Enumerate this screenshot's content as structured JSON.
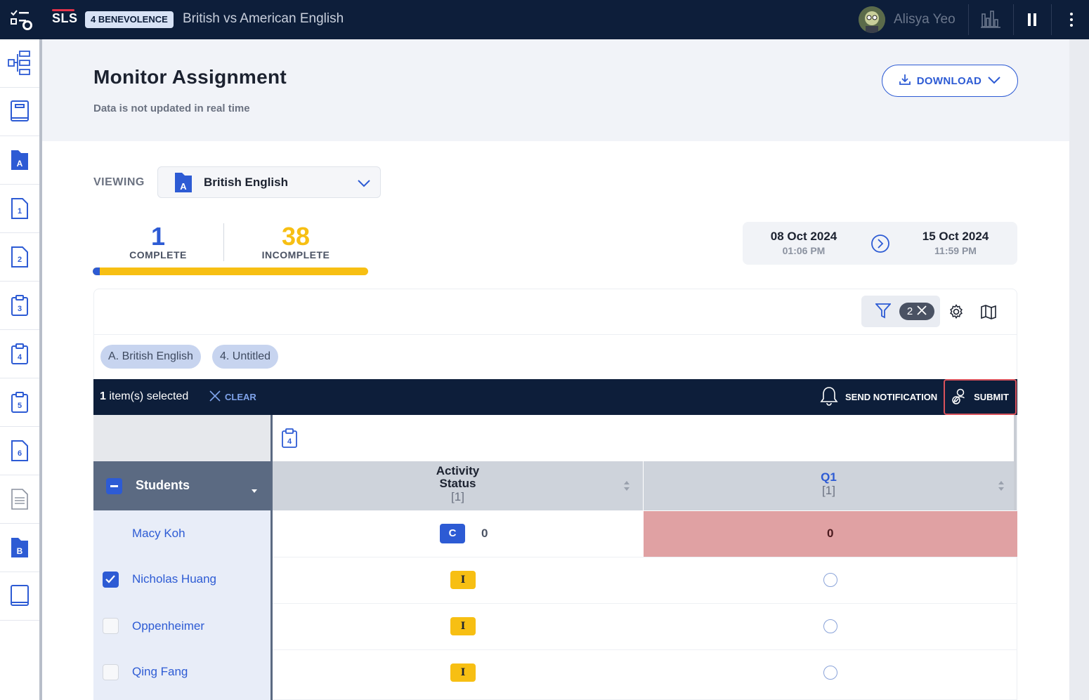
{
  "topbar": {
    "logo": "SLS",
    "class_badge": "4 BENEVOLENCE",
    "lesson_title": "British vs American English",
    "user_name": "Alisya Yeo"
  },
  "rail": {
    "items": [
      {
        "icon": "tree-structure-icon"
      },
      {
        "icon": "book-icon"
      },
      {
        "icon": "folder-a-icon",
        "label": "A"
      },
      {
        "icon": "page-1-icon",
        "label": "1"
      },
      {
        "icon": "page-2-icon",
        "label": "2"
      },
      {
        "icon": "clipboard-3-icon",
        "label": "3"
      },
      {
        "icon": "clipboard-4-icon",
        "label": "4"
      },
      {
        "icon": "clipboard-5-icon",
        "label": "5"
      },
      {
        "icon": "page-6-icon",
        "label": "6"
      },
      {
        "icon": "document-icon"
      },
      {
        "icon": "folder-b-icon",
        "label": "B"
      },
      {
        "icon": "book-end-icon"
      }
    ]
  },
  "header": {
    "title": "Monitor Assignment",
    "subtitle": "Data is not updated in real time",
    "download_label": "DOWNLOAD"
  },
  "viewing": {
    "label": "VIEWING",
    "folder_letter": "A",
    "selected": "British English"
  },
  "stats": {
    "complete_count": "1",
    "complete_label": "COMPLETE",
    "incomplete_count": "38",
    "incomplete_label": "INCOMPLETE",
    "progress_fraction": 0.026
  },
  "dates": {
    "start_date": "08 Oct 2024",
    "start_time": "01:06 PM",
    "end_date": "15 Oct 2024",
    "end_time": "11:59 PM"
  },
  "filters": {
    "count": "2",
    "chips": [
      "A. British English",
      "4. Untitled"
    ]
  },
  "selection": {
    "count": "1",
    "text": "item(s) selected",
    "clear": "CLEAR",
    "notify": "SEND NOTIFICATION",
    "submit": "SUBMIT"
  },
  "table": {
    "group_number": "4",
    "students_header": "Students",
    "col_activity_1": "Activity",
    "col_activity_2": "Status",
    "col_activity_sub": "[1]",
    "col_q1": "Q1",
    "col_q1_sub": "[1]",
    "rows": [
      {
        "name": "Macy Koh",
        "checked": false,
        "status": "C",
        "score": "0",
        "q1": "0"
      },
      {
        "name": "Nicholas Huang",
        "checked": true,
        "status": "I",
        "score": "",
        "q1": ""
      },
      {
        "name": "Oppenheimer",
        "checked": false,
        "status": "I",
        "score": "",
        "q1": ""
      },
      {
        "name": "Qing Fang",
        "checked": false,
        "status": "I",
        "score": "",
        "q1": ""
      }
    ]
  },
  "colors": {
    "navy": "#0d1e3a",
    "accent_blue": "#2d5bd4",
    "incomplete_yellow": "#f7bf13",
    "highlight_red": "#e0a1a3"
  }
}
